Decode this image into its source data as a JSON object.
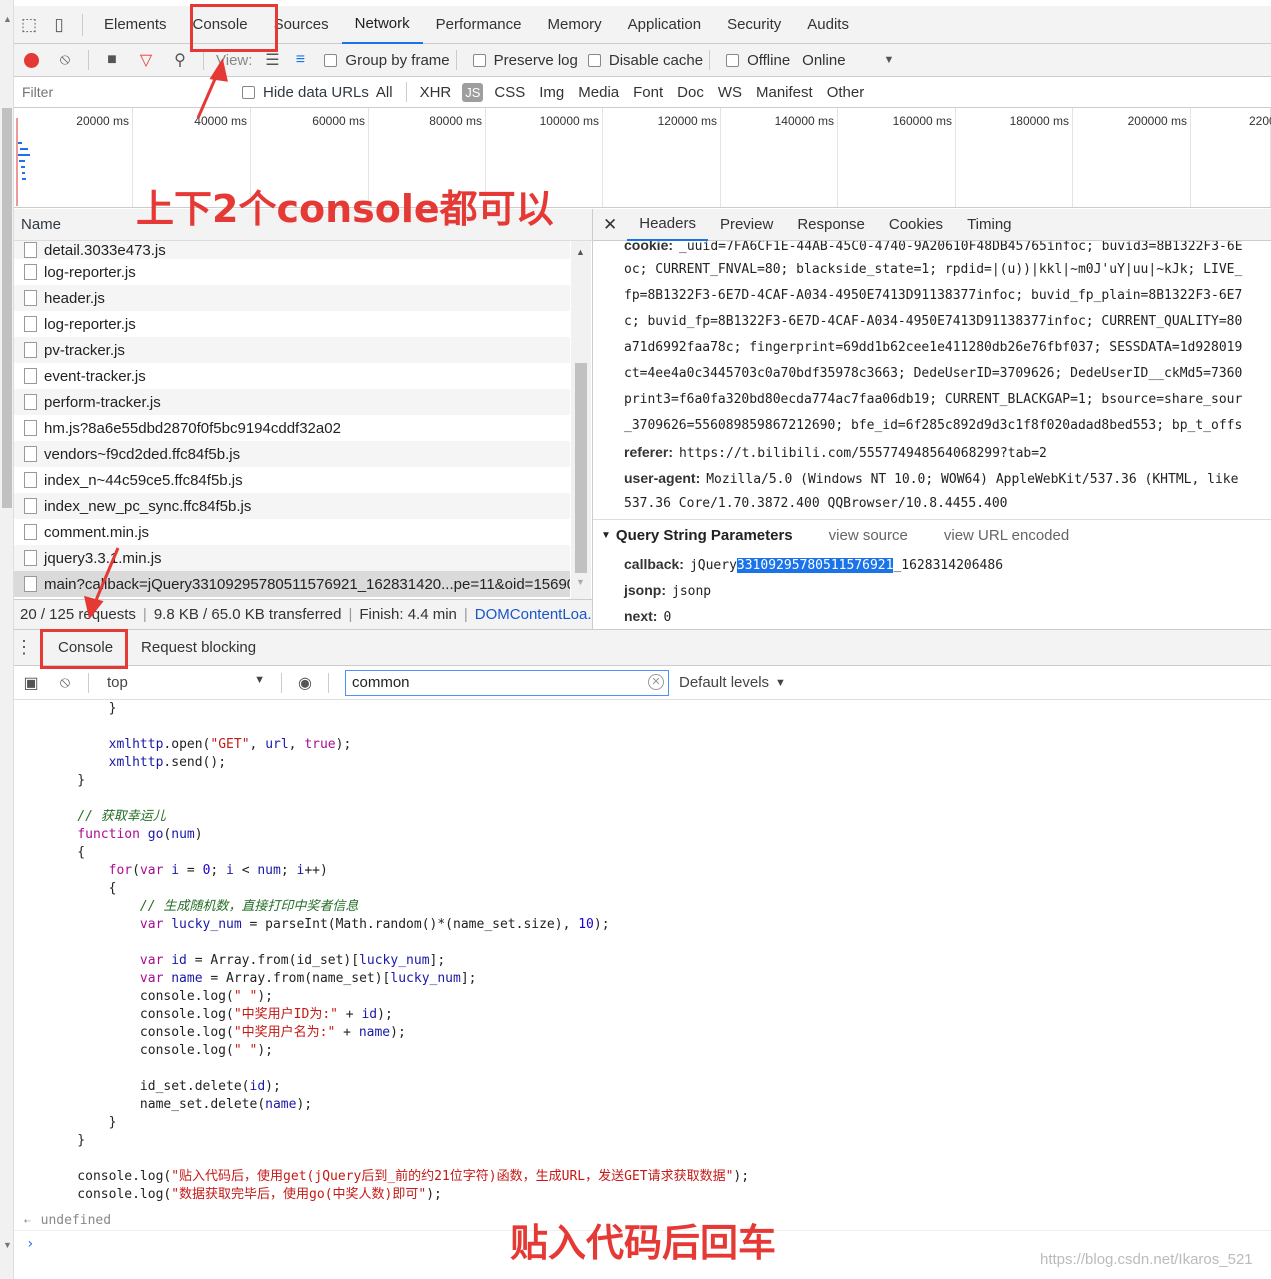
{
  "main_tabs": [
    "Elements",
    "Console",
    "Sources",
    "Network",
    "Performance",
    "Memory",
    "Application",
    "Security",
    "Audits"
  ],
  "active_main_tab": "Network",
  "toolbar": {
    "view_label": "View:",
    "group_by_frame": "Group by frame",
    "preserve_log": "Preserve log",
    "disable_cache": "Disable cache",
    "offline": "Offline",
    "throttle": "Online"
  },
  "filter": {
    "placeholder": "Filter",
    "hide_data_urls": "Hide data URLs",
    "types": [
      "All",
      "XHR",
      "JS",
      "CSS",
      "Img",
      "Media",
      "Font",
      "Doc",
      "WS",
      "Manifest",
      "Other"
    ],
    "active_type": "JS"
  },
  "timeline": {
    "ticks": [
      "20000 ms",
      "40000 ms",
      "60000 ms",
      "80000 ms",
      "100000 ms",
      "120000 ms",
      "140000 ms",
      "160000 ms",
      "180000 ms",
      "200000 ms",
      "2200"
    ]
  },
  "requests": {
    "column_name": "Name",
    "rows": [
      "detail.3033e473.js",
      "log-reporter.js",
      "header.js",
      "log-reporter.js",
      "pv-tracker.js",
      "event-tracker.js",
      "perform-tracker.js",
      "hm.js?8a6e55dbd2870f0f5bc9194cddf32a02",
      "vendors~f9cd2ded.ffc84f5b.js",
      "index_n~44c59ce5.ffc84f5b.js",
      "index_new_pc_sync.ffc84f5b.js",
      "comment.min.js",
      "jquery3.3.1.min.js",
      "main?callback=jQuery33109295780511576921_162831420...pe=11&oid=15690..."
    ],
    "selected_index": 13
  },
  "status": {
    "requests": "20 / 125 requests",
    "transferred": "9.8 KB / 65.0 KB transferred",
    "finish": "Finish: 4.4 min",
    "dom_content": "DOMContentLoa..."
  },
  "detail_tabs": [
    "Headers",
    "Preview",
    "Response",
    "Cookies",
    "Timing"
  ],
  "active_detail_tab": "Headers",
  "headers": {
    "cookie_lines": [
      "_uuid=7FA6CF1E-44AB-45C0-4740-9A20610F48DB45765infoc; buvid3=8B1322F3-6E",
      "oc; CURRENT_FNVAL=80; blackside_state=1; rpdid=|(u))|kkl|~m0J'uY|uu|~kJk; LIVE_",
      "fp=8B1322F3-6E7D-4CAF-A034-4950E7413D91138377infoc; buvid_fp_plain=8B1322F3-6E7",
      "c; buvid_fp=8B1322F3-6E7D-4CAF-A034-4950E7413D91138377infoc; CURRENT_QUALITY=80",
      "a71d6992faa78c; fingerprint=69dd1b62cee1e411280db26e76fbf037; SESSDATA=1d928019",
      "ct=4ee4a0c3445703c0a70bdf35978c3663; DedeUserID=3709626; DedeUserID__ckMd5=7360",
      "print3=f6a0fa320bd80ecda774ac7faa06db19; CURRENT_BLACKGAP=1; bsource=share_sour",
      "_3709626=556089859867212690; bfe_id=6f285c892d9d3c1f8f020adad8bed553; bp_t_offs"
    ],
    "cookie_key": "cookie:",
    "referer_key": "referer:",
    "referer_value": "https://t.bilibili.com/555774948564068299?tab=2",
    "ua_key": "user-agent:",
    "ua_value": "Mozilla/5.0 (Windows NT 10.0; WOW64) AppleWebKit/537.36 (KHTML, like",
    "ua_value_2": "537.36 Core/1.70.3872.400 QQBrowser/10.8.4455.400"
  },
  "query_params": {
    "title": "Query String Parameters",
    "view_source": "view source",
    "view_url_encoded": "view URL encoded",
    "callback_key": "callback:",
    "callback_prefix": "jQuery",
    "callback_highlight": "33109295780511576921",
    "callback_suffix": "_1628314206486",
    "jsonp_key": "jsonp:",
    "jsonp_value": "jsonp",
    "next_key": "next:",
    "next_value": "0"
  },
  "drawer": {
    "tabs": [
      "Console",
      "Request blocking"
    ],
    "context": "top",
    "filter_value": "common",
    "levels": "Default levels"
  },
  "console": {
    "result": "undefined"
  },
  "annotations": {
    "top_note": "上下2个console都可以",
    "bottom_note": "贴入代码后回车",
    "watermark": "https://blog.csdn.net/Ikaros_521"
  },
  "colors": {
    "accent": "#1a73e8",
    "annotation": "#e53935",
    "record": "#e53935"
  }
}
